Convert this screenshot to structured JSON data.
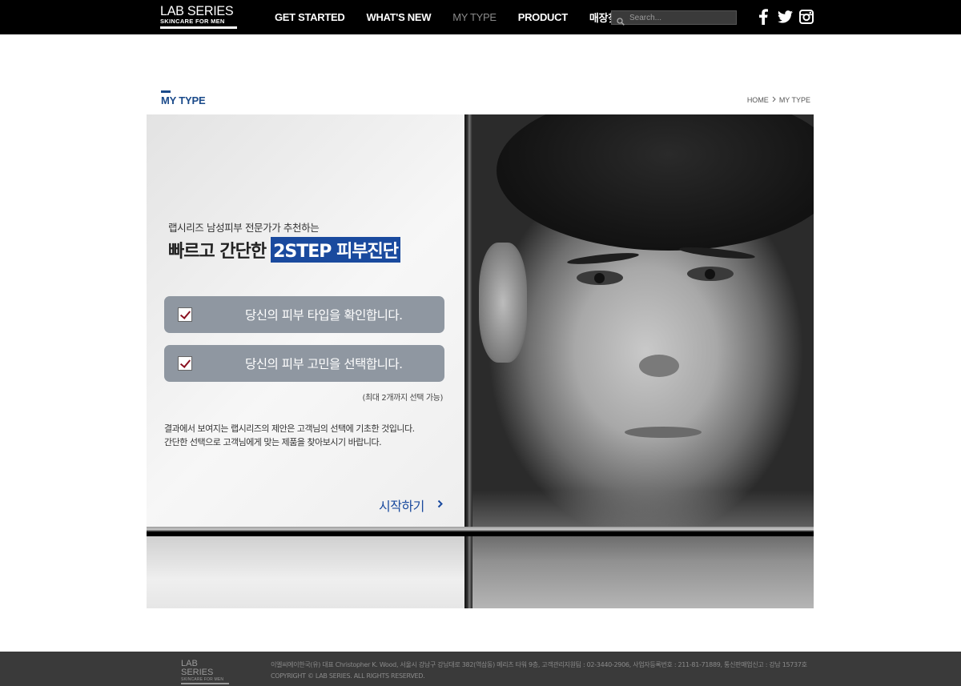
{
  "header": {
    "logo_line1": "LAB SERIES",
    "logo_line2": "SKINCARE FOR MEN",
    "nav": [
      {
        "label": "GET STARTED"
      },
      {
        "label": "WHAT'S NEW"
      },
      {
        "label": "MY TYPE",
        "active": true
      },
      {
        "label": "PRODUCT"
      },
      {
        "label": "매장찾기"
      }
    ],
    "search_placeholder": "Search...",
    "social": [
      {
        "icon": "facebook-icon",
        "glyph": "f"
      },
      {
        "icon": "twitter-icon",
        "glyph": "t"
      },
      {
        "icon": "instagram-icon",
        "glyph": "o"
      }
    ]
  },
  "page": {
    "title": "MY TYPE",
    "breadcrumb": [
      "HOME",
      "MY TYPE"
    ]
  },
  "hero": {
    "subtitle": "랩시리즈 남성피부 전문가가 추천하는",
    "headline_plain": "빠르고 간단한",
    "headline_highlight": "2STEP 피부진단",
    "steps": [
      {
        "label": "당신의 피부 타입을 확인합니다.",
        "checked": true
      },
      {
        "label": "당신의 피부 고민을 선택합니다.",
        "checked": true
      }
    ],
    "note": "(최대 2개까지 선택 가능)",
    "description_line1": "결과에서 보여지는 랩시리즈의 제안은 고객님의 선택에 기초한 것입니다.",
    "description_line2": "간단한 선택으로 고객님에게 맞는 제품을 찾아보시기 바랍니다.",
    "start_label": "시작하기"
  },
  "footer": {
    "logo_line1": "LAB SERIES",
    "logo_line2": "SKINCARE FOR MEN",
    "company_info": "이엘씨에이한국(유) 대표 Christopher K. Wood, 서울시 강남구 강남대로 382(역삼동) 메리츠 타워 9층, 고객관리지원팀 : 02-3440-2906, 사업자등록번호 : 211-81-71889, 통신판매업신고 : 강남 15737호",
    "copyright": "COPYRIGHT © LAB SERIES. ALL RIGHTS RESERVED."
  },
  "colors": {
    "accent_blue": "#1a4a9e",
    "step_bg": "#8f97a1",
    "check_mark": "#8a1020",
    "footer_bg": "#3a3a3a"
  }
}
